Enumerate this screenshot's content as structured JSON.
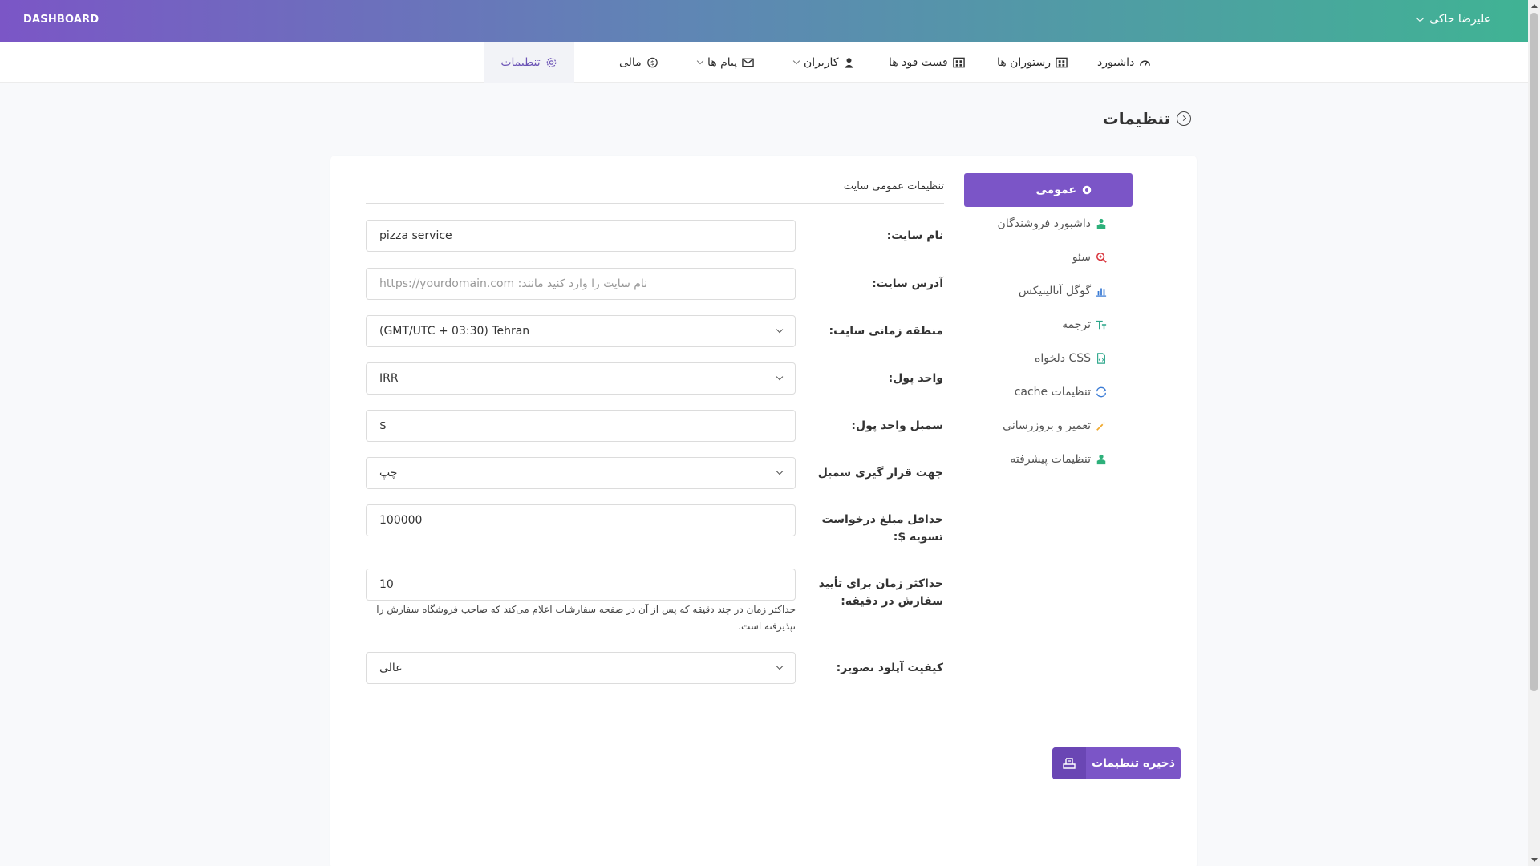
{
  "header": {
    "brand": "DASHBOARD",
    "user_name": "علیرضا حاکی"
  },
  "nav": {
    "items": [
      {
        "label": "داشبورد",
        "icon": "gauge-icon"
      },
      {
        "label": "رستوران ها",
        "icon": "store-icon"
      },
      {
        "label": "فست فود ها",
        "icon": "store-icon"
      },
      {
        "label": "کاربران",
        "icon": "user-icon"
      },
      {
        "label": "پیام ها",
        "icon": "envelope-icon"
      },
      {
        "label": "مالی",
        "icon": "dollar-circle-icon"
      },
      {
        "label": "تنظیمات",
        "icon": "gear-icon",
        "active": true
      }
    ]
  },
  "page": {
    "title": "تنظیمات"
  },
  "side_menu": {
    "items": [
      {
        "label": "عمومی",
        "icon": "gear-icon",
        "active": true
      },
      {
        "label": "داشبورد فروشندگان",
        "icon": "user-tie-icon"
      },
      {
        "label": "سئو",
        "icon": "search-plus-icon"
      },
      {
        "label": "گوگل آنالیتیکس",
        "icon": "bar-chart-icon"
      },
      {
        "label": "ترجمه",
        "icon": "text-size-icon"
      },
      {
        "label": "CSS دلخواه",
        "icon": "file-code-icon"
      },
      {
        "label": "تنظیمات cache",
        "icon": "refresh-icon"
      },
      {
        "label": "تعمیر و بروزرسانی",
        "icon": "magic-wand-icon"
      },
      {
        "label": "تنظیمات پیشرفته",
        "icon": "user-tie-icon"
      }
    ]
  },
  "form": {
    "section_title": "تنظیمات عمومی سایت",
    "fields": {
      "site_name": {
        "label": "نام سایت:",
        "value": "pizza service"
      },
      "site_url": {
        "label": "آدرس سایت:",
        "value": "",
        "placeholder": "نام سایت را وارد کنید مانند: https://yourdomain.com"
      },
      "timezone": {
        "label": "منطقه زمانی سایت:",
        "value": "(GMT/UTC + 03:30) Tehran"
      },
      "currency": {
        "label": "واحد پول:",
        "value": "IRR"
      },
      "currency_symbol": {
        "label": "سمبل واحد پول:",
        "value": "$"
      },
      "symbol_position": {
        "label": "جهت قرار گیری سمبل",
        "value": "چپ"
      },
      "min_settlement": {
        "label": "حداقل مبلغ درخواست تسویه $:",
        "value": "100000"
      },
      "max_confirm_time": {
        "label": "حداکثر زمان برای تأیید سفارش در دقیقه:",
        "value": "10",
        "help": "حداکثر زمان در چند دقیقه که پس از آن در صفحه سفارشات اعلام می‌کند که صاحب فروشگاه سفارش را نپذیرفته است."
      },
      "image_quality": {
        "label": "کیفیت آپلود تصویر:",
        "value": "عالی"
      }
    },
    "save_label": "ذخیره تنظیمات"
  },
  "colors": {
    "accent": "#7b55c7",
    "gradient_start": "#7b56c6",
    "gradient_end": "#40b394"
  }
}
